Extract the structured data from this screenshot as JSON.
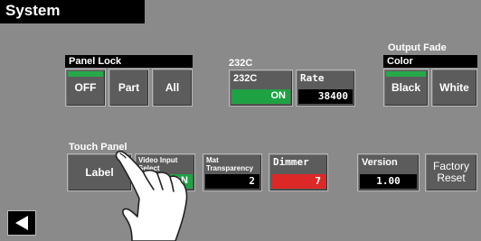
{
  "title": "System",
  "panel_lock": {
    "label": "Panel Lock",
    "buttons": [
      "OFF",
      "Part",
      "All"
    ]
  },
  "rs232c": {
    "header": "232C",
    "port_label": "232C",
    "port_value": "ON",
    "rate_label": "Rate",
    "rate_value": "38400"
  },
  "output_fade": {
    "header": "Output Fade",
    "label": "Color",
    "buttons": [
      "Black",
      "White"
    ]
  },
  "touch_panel": {
    "header": "Touch Panel",
    "label_button": "Label",
    "video_input_select_label": "Video Input\nSelect",
    "video_input_select_value": "ON"
  },
  "mat_transparency": {
    "label": "Mat\nTransparency",
    "value": "2"
  },
  "dimmer": {
    "label": "Dimmer",
    "value": "7"
  },
  "version": {
    "label": "Version",
    "value": "1.00"
  },
  "factory_reset": {
    "label": "Factory\nReset"
  },
  "colors": {
    "background": "#8a8a8a",
    "active_green": "#1fa244",
    "dimmer_red": "#dd2828"
  },
  "icons": {
    "back": "left-triangle-icon",
    "pointer": "hand-pointer-icon"
  }
}
